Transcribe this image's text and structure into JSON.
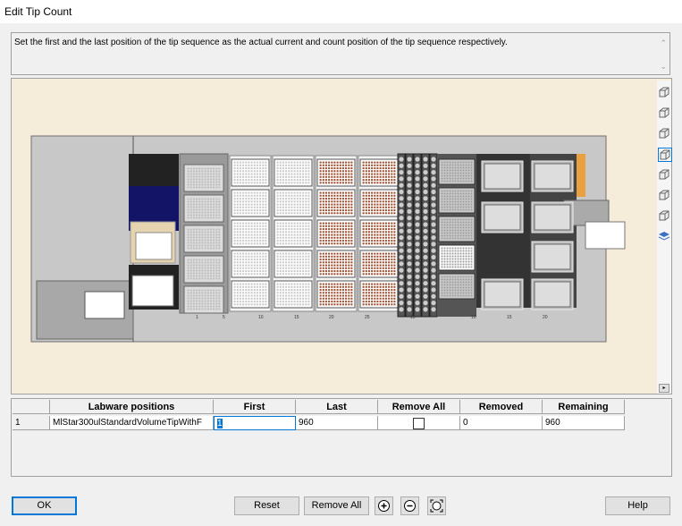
{
  "window": {
    "title": "Edit Tip Count"
  },
  "instruction": "Set the first and the last position of the tip sequence as the actual  current and count position of the tip sequence respectively.",
  "deck": {
    "track_labels": [
      "1",
      "5",
      "10",
      "15",
      "20",
      "25",
      "15",
      "10",
      "15",
      "20"
    ],
    "toolbar_icons": [
      "view-iso-1-icon",
      "view-iso-2-icon",
      "view-iso-3-icon",
      "view-iso-4-icon",
      "view-iso-5-icon",
      "view-iso-6-icon",
      "view-iso-7-icon",
      "layers-icon"
    ]
  },
  "table": {
    "headers": [
      "Labware positions",
      "First",
      "Last",
      "Remove All",
      "Removed",
      "Remaining"
    ],
    "rows": [
      {
        "index": "1",
        "labware": "MlStar300ulStandardVolumeTipWithF",
        "first": "1",
        "last": "960",
        "remove_all": false,
        "removed": "0",
        "remaining": "960"
      }
    ]
  },
  "buttons": {
    "ok": "OK",
    "reset": "Reset",
    "remove_all": "Remove All",
    "help": "Help"
  },
  "icons": {
    "zoom_in": "zoom-in-icon",
    "zoom_out": "zoom-out-icon",
    "fit": "zoom-fit-icon"
  }
}
